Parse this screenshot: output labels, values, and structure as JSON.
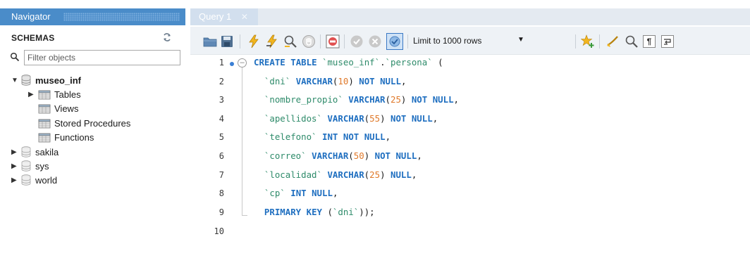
{
  "navigator": {
    "title": "Navigator",
    "schemas_label": "SCHEMAS",
    "filter_placeholder": "Filter objects",
    "schemas": [
      {
        "name": "museo_inf",
        "expanded": true,
        "children": [
          "Tables",
          "Views",
          "Stored Procedures",
          "Functions"
        ]
      },
      {
        "name": "sakila",
        "expanded": false
      },
      {
        "name": "sys",
        "expanded": false
      },
      {
        "name": "world",
        "expanded": false
      }
    ]
  },
  "editor": {
    "tab_label": "Query 1",
    "limit_label": "Limit to 1000 rows",
    "line_numbers": [
      "1",
      "2",
      "3",
      "4",
      "5",
      "6",
      "7",
      "8",
      "9",
      "10"
    ],
    "lines": [
      "CREATE TABLE `museo_inf`.`persona` (",
      "  `dni` VARCHAR(10) NOT NULL,",
      "  `nombre_propio` VARCHAR(25) NOT NULL,",
      "  `apellidos` VARCHAR(55) NOT NULL,",
      "  `telefono` INT NOT NULL,",
      "  `correo` VARCHAR(50) NOT NULL,",
      "  `localidad` VARCHAR(25) NULL,",
      "  `cp` INT NULL,",
      "  PRIMARY KEY (`dni`));",
      ""
    ]
  },
  "colors": {
    "navigator_header": "#4a8cc9",
    "keyword": "#1f6fc0",
    "identifier": "#2e8b6a",
    "number": "#e0792a"
  },
  "icons": {
    "toolbar": [
      "open-file-icon",
      "save-icon",
      "execute-icon",
      "execute-statement-icon",
      "explain-icon",
      "stop-icon",
      "toggle-error-icon",
      "commit-icon",
      "rollback-icon",
      "autocommit-icon",
      "add-snippet-icon",
      "beautify-icon",
      "find-icon",
      "invisible-chars-icon",
      "wrap-icon"
    ]
  }
}
